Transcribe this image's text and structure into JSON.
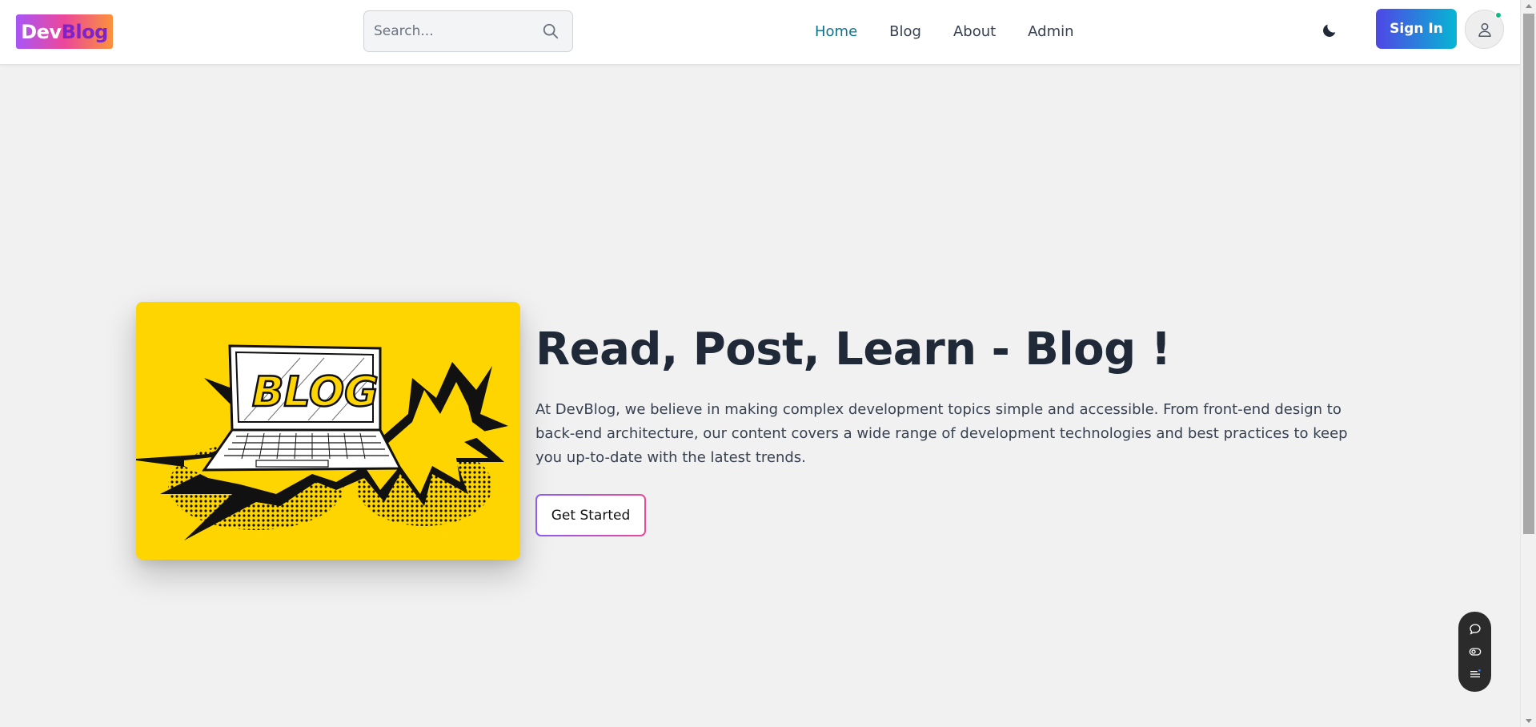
{
  "header": {
    "logo": {
      "part1": "Dev",
      "part2": "Blog"
    },
    "search": {
      "placeholder": "Search...",
      "value": ""
    },
    "nav": [
      {
        "label": "Home",
        "active": true
      },
      {
        "label": "Blog",
        "active": false
      },
      {
        "label": "About",
        "active": false
      },
      {
        "label": "Admin",
        "active": false
      }
    ],
    "theme_icon": "moon-icon",
    "signin_label": "Sign In",
    "avatar_icon": "user-icon",
    "avatar_status": "online"
  },
  "hero": {
    "image_text": "BLOG",
    "title": "Read, Post, Learn - Blog !",
    "description": "At DevBlog, we believe in making complex development topics simple and accessible. From front-end design to back-end architecture, our content covers a wide range of development technologies and best practices to keep you up-to-date with the latest trends.",
    "cta_label": "Get Started"
  },
  "floating_toolbar": {
    "icons": [
      "chat-icon",
      "eye-toggle-icon",
      "list-icon"
    ]
  },
  "colors": {
    "page_bg": "#f1f1f1",
    "nav_active": "#0e7490",
    "hero_card": "#ffd500",
    "signin_gradient_start": "#4f46e5",
    "signin_gradient_end": "#06b6d4",
    "cta_border_start": "#8b5cf6",
    "cta_border_end": "#ec4899",
    "status_online": "#10b981"
  }
}
